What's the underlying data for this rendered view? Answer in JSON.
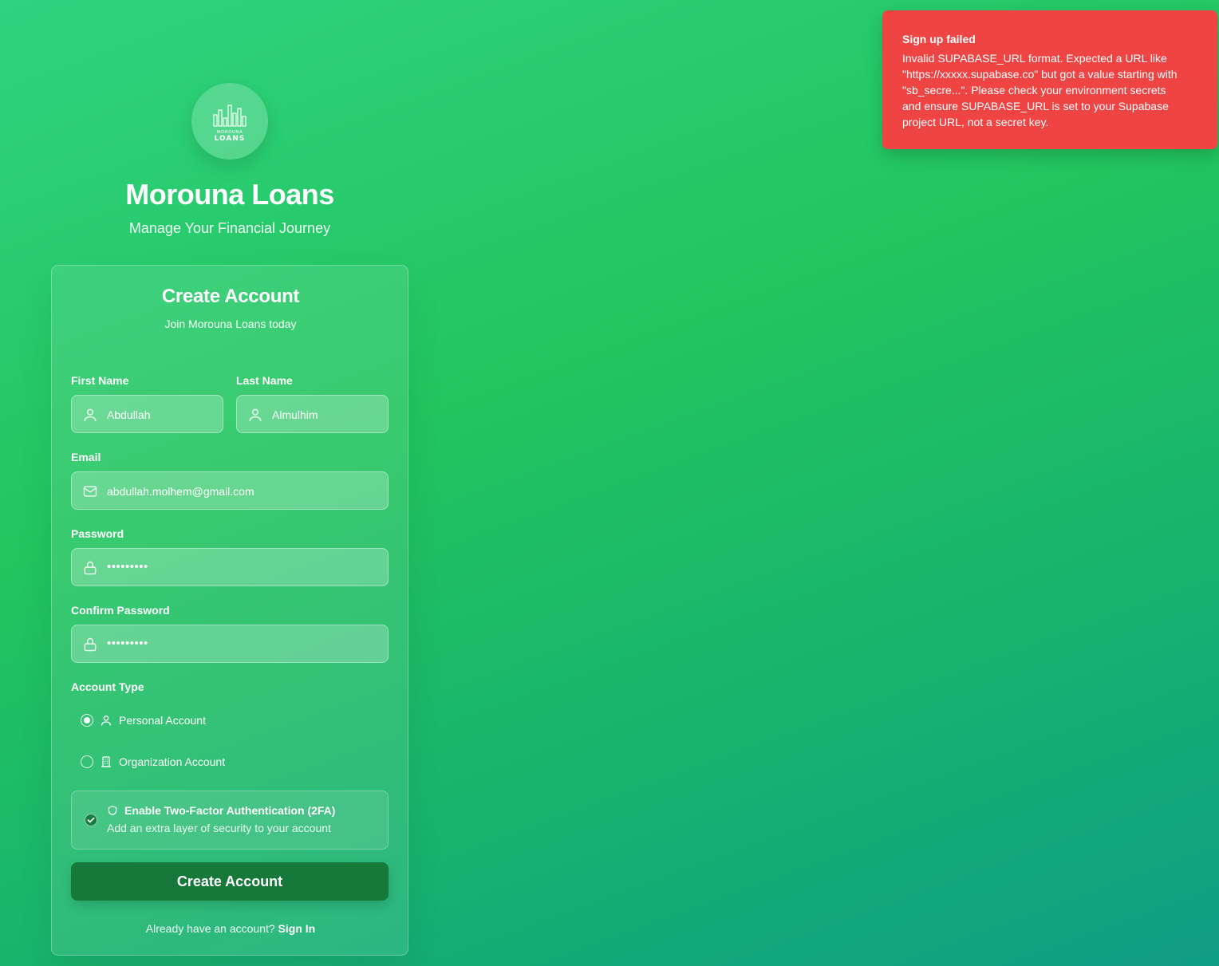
{
  "toast": {
    "title": "Sign up failed",
    "message": "Invalid SUPABASE_URL format. Expected a URL like \"https://xxxxx.supabase.co\" but got a value starting with \"sb_secre...\". Please check your environment secrets and ensure SUPABASE_URL is set to your Supabase project URL, not a secret key."
  },
  "brand": {
    "logo_top": "MOROUNA",
    "logo_bottom": "LOANS",
    "title": "Morouna Loans",
    "subtitle": "Manage Your Financial Journey"
  },
  "form": {
    "title": "Create Account",
    "subtitle": "Join Morouna Loans today",
    "first_name": {
      "label": "First Name",
      "value": "Abdullah",
      "icon": "user-icon"
    },
    "last_name": {
      "label": "Last Name",
      "value": "Almulhim",
      "icon": "user-icon"
    },
    "email": {
      "label": "Email",
      "value": "abdullah.molhem@gmail.com",
      "icon": "mail-icon"
    },
    "password": {
      "label": "Password",
      "value": "•••••••••",
      "icon": "lock-icon"
    },
    "confirm_password": {
      "label": "Confirm Password",
      "value": "•••••••••",
      "icon": "lock-icon"
    },
    "account_type": {
      "label": "Account Type",
      "options": [
        {
          "label": "Personal Account",
          "icon": "user-icon",
          "selected": true
        },
        {
          "label": "Organization Account",
          "icon": "building-icon",
          "selected": false
        }
      ]
    },
    "two_factor": {
      "title": "Enable Two-Factor Authentication (2FA)",
      "description": "Add an extra layer of security to your account",
      "checked": true,
      "icon": "shield-icon"
    },
    "submit_label": "Create Account",
    "footer_text": "Already have an account?",
    "footer_link": "Sign In"
  },
  "colors": {
    "toast_bg": "#ef4444",
    "button_bg": "#16793a",
    "bg_start": "#2fd37f",
    "bg_end": "#0f9d86"
  }
}
